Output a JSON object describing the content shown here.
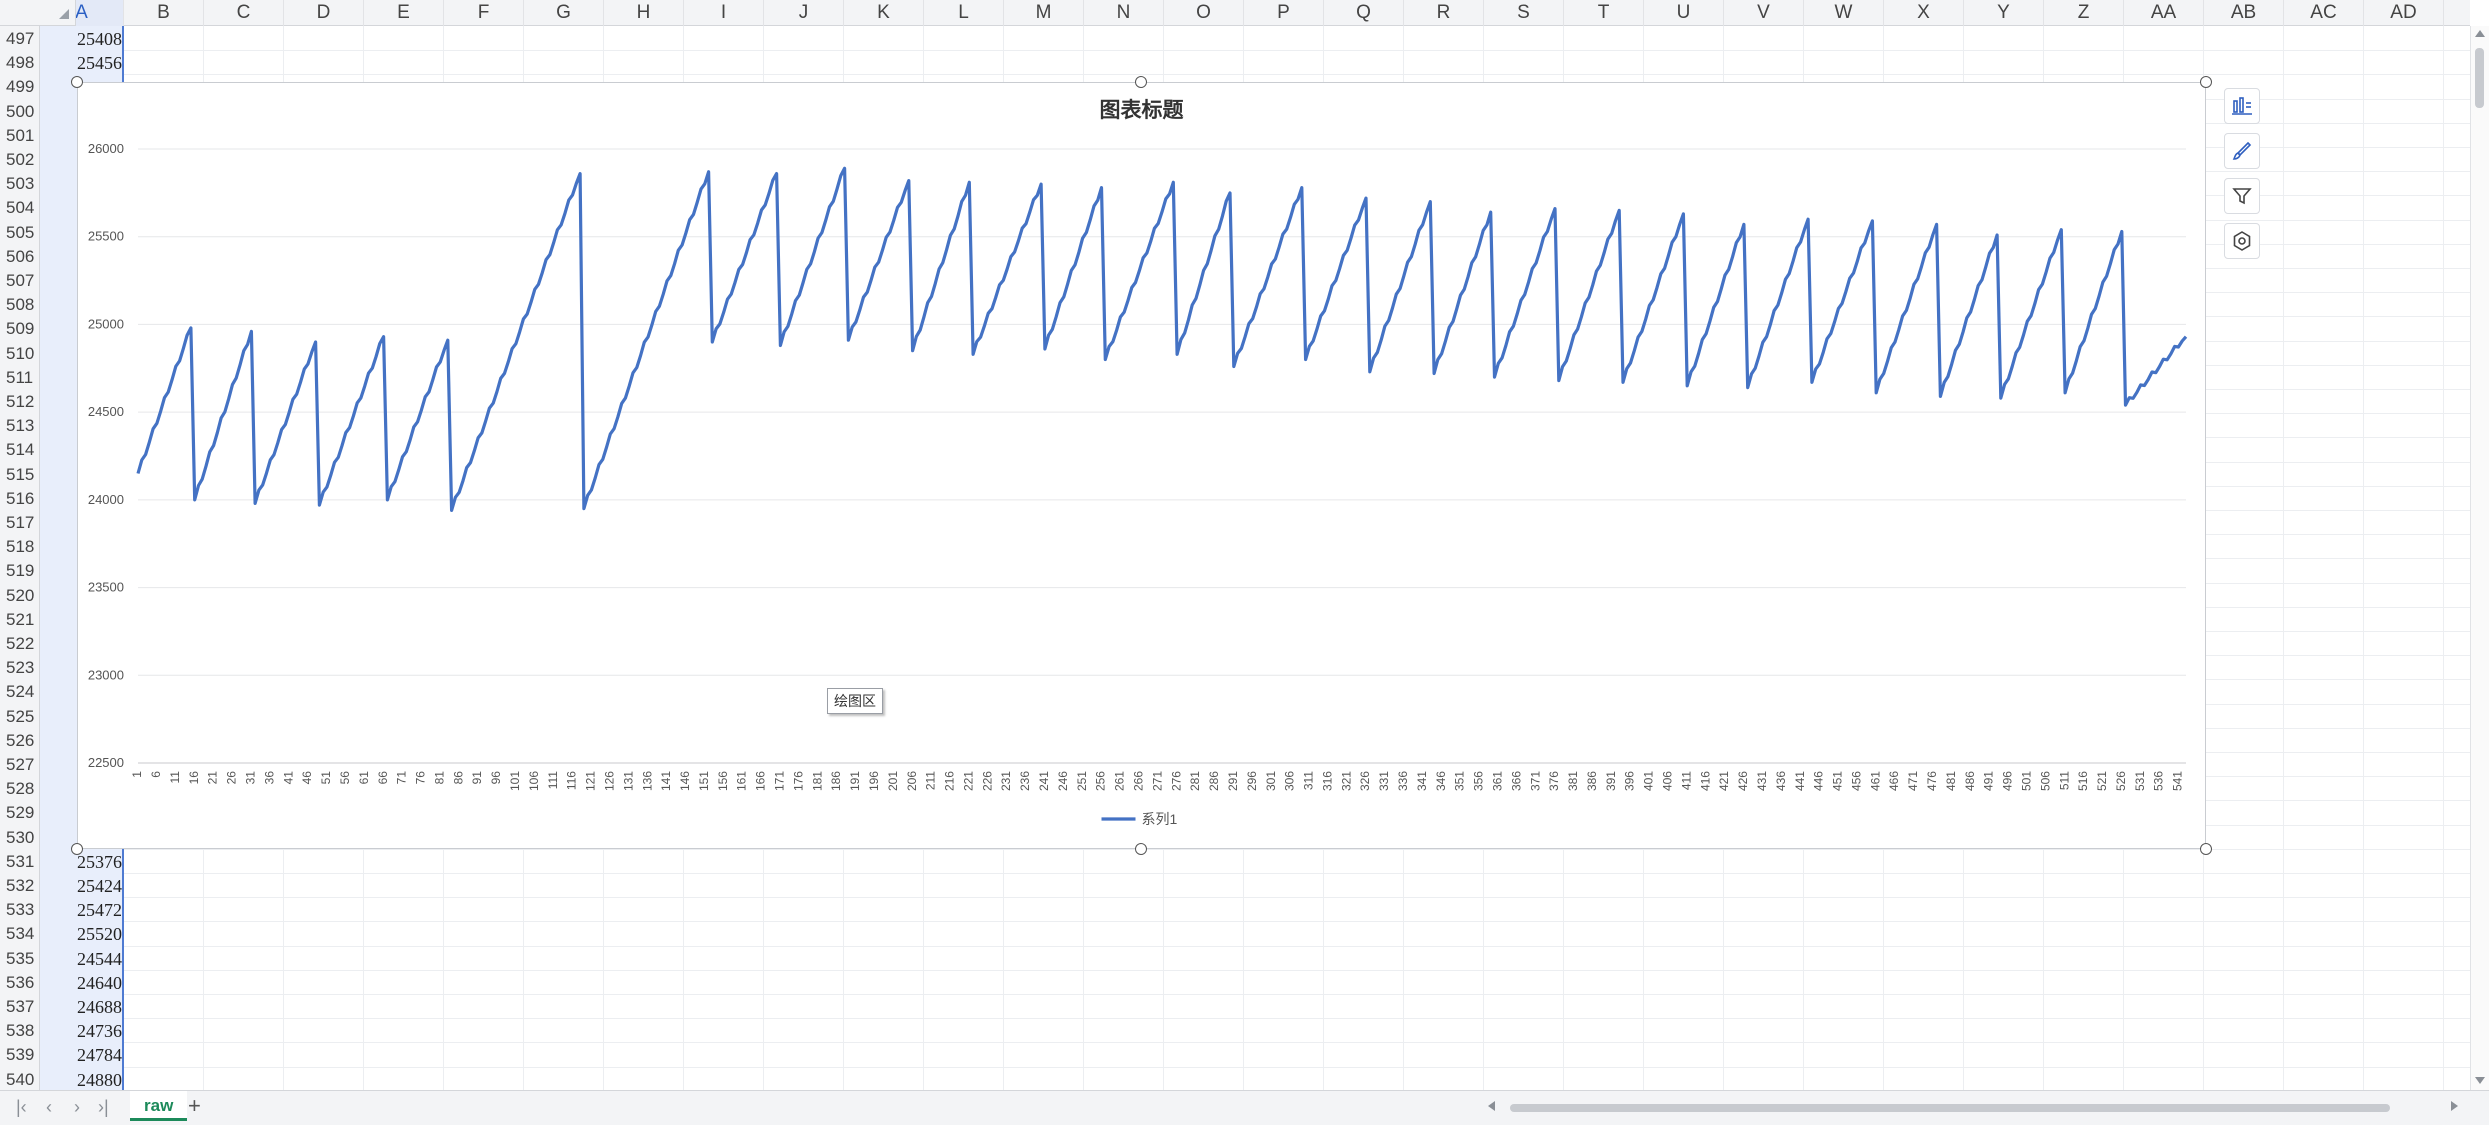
{
  "columns": [
    "A",
    "B",
    "C",
    "D",
    "E",
    "F",
    "G",
    "H",
    "I",
    "J",
    "K",
    "L",
    "M",
    "N",
    "O",
    "P",
    "Q",
    "R",
    "S",
    "T",
    "U",
    "V",
    "W",
    "X",
    "Y",
    "Z",
    "AA",
    "AB",
    "AC",
    "AD"
  ],
  "rows": [
    497,
    498,
    499,
    500,
    501,
    502,
    503,
    504,
    505,
    506,
    507,
    508,
    509,
    510,
    511,
    512,
    513,
    514,
    515,
    516,
    517,
    518,
    519,
    520,
    521,
    522,
    523,
    524,
    525,
    526,
    527,
    528,
    529,
    530,
    531,
    532,
    533,
    534,
    535,
    536,
    537,
    538,
    539,
    540
  ],
  "colA_values_top": [
    "25408",
    "25456"
  ],
  "colA_values_bottom": [
    "25376",
    "25424",
    "25472",
    "25520",
    "24544",
    "24640",
    "24688",
    "24736",
    "24784",
    "24880"
  ],
  "sheet_tab": "raw",
  "add_sheet": "+",
  "tooltip": "绘图区",
  "chart_data": {
    "type": "line",
    "title": "图表标题",
    "ylim": [
      22500,
      26000
    ],
    "yticks": [
      22500,
      23000,
      23500,
      24000,
      24500,
      25000,
      25500,
      26000
    ],
    "x_start": 1,
    "x_end": 543,
    "x_tick_step": 5,
    "series": [
      {
        "name": "系列1",
        "color": "#4472c4",
        "cycles": [
          {
            "x_start": 1,
            "x_end": 15,
            "low": 24150,
            "high": 24980
          },
          {
            "x_start": 16,
            "x_end": 31,
            "low": 24000,
            "high": 24960
          },
          {
            "x_start": 32,
            "x_end": 48,
            "low": 23980,
            "high": 24900
          },
          {
            "x_start": 49,
            "x_end": 66,
            "low": 23970,
            "high": 24930
          },
          {
            "x_start": 67,
            "x_end": 83,
            "low": 24000,
            "high": 24910
          },
          {
            "x_start": 84,
            "x_end": 118,
            "low": 23940,
            "high": 25860
          },
          {
            "x_start": 119,
            "x_end": 152,
            "low": 23950,
            "high": 25870
          },
          {
            "x_start": 153,
            "x_end": 170,
            "low": 24900,
            "high": 25860
          },
          {
            "x_start": 171,
            "x_end": 188,
            "low": 24880,
            "high": 25890
          },
          {
            "x_start": 189,
            "x_end": 205,
            "low": 24910,
            "high": 25820
          },
          {
            "x_start": 206,
            "x_end": 221,
            "low": 24850,
            "high": 25810
          },
          {
            "x_start": 222,
            "x_end": 240,
            "low": 24830,
            "high": 25800
          },
          {
            "x_start": 241,
            "x_end": 256,
            "low": 24860,
            "high": 25780
          },
          {
            "x_start": 257,
            "x_end": 275,
            "low": 24800,
            "high": 25810
          },
          {
            "x_start": 276,
            "x_end": 290,
            "low": 24830,
            "high": 25750
          },
          {
            "x_start": 291,
            "x_end": 309,
            "low": 24760,
            "high": 25780
          },
          {
            "x_start": 310,
            "x_end": 326,
            "low": 24800,
            "high": 25720
          },
          {
            "x_start": 327,
            "x_end": 343,
            "low": 24730,
            "high": 25700
          },
          {
            "x_start": 344,
            "x_end": 359,
            "low": 24720,
            "high": 25640
          },
          {
            "x_start": 360,
            "x_end": 376,
            "low": 24700,
            "high": 25660
          },
          {
            "x_start": 377,
            "x_end": 393,
            "low": 24680,
            "high": 25650
          },
          {
            "x_start": 394,
            "x_end": 410,
            "low": 24670,
            "high": 25630
          },
          {
            "x_start": 411,
            "x_end": 426,
            "low": 24650,
            "high": 25570
          },
          {
            "x_start": 427,
            "x_end": 443,
            "low": 24640,
            "high": 25600
          },
          {
            "x_start": 444,
            "x_end": 460,
            "low": 24670,
            "high": 25590
          },
          {
            "x_start": 461,
            "x_end": 477,
            "low": 24610,
            "high": 25570
          },
          {
            "x_start": 478,
            "x_end": 493,
            "low": 24590,
            "high": 25510
          },
          {
            "x_start": 494,
            "x_end": 510,
            "low": 24580,
            "high": 25540
          },
          {
            "x_start": 511,
            "x_end": 526,
            "low": 24610,
            "high": 25530
          },
          {
            "x_start": 527,
            "x_end": 543,
            "low": 24540,
            "high": 24930
          }
        ]
      }
    ],
    "legend": "bottom-center",
    "grid": true
  }
}
